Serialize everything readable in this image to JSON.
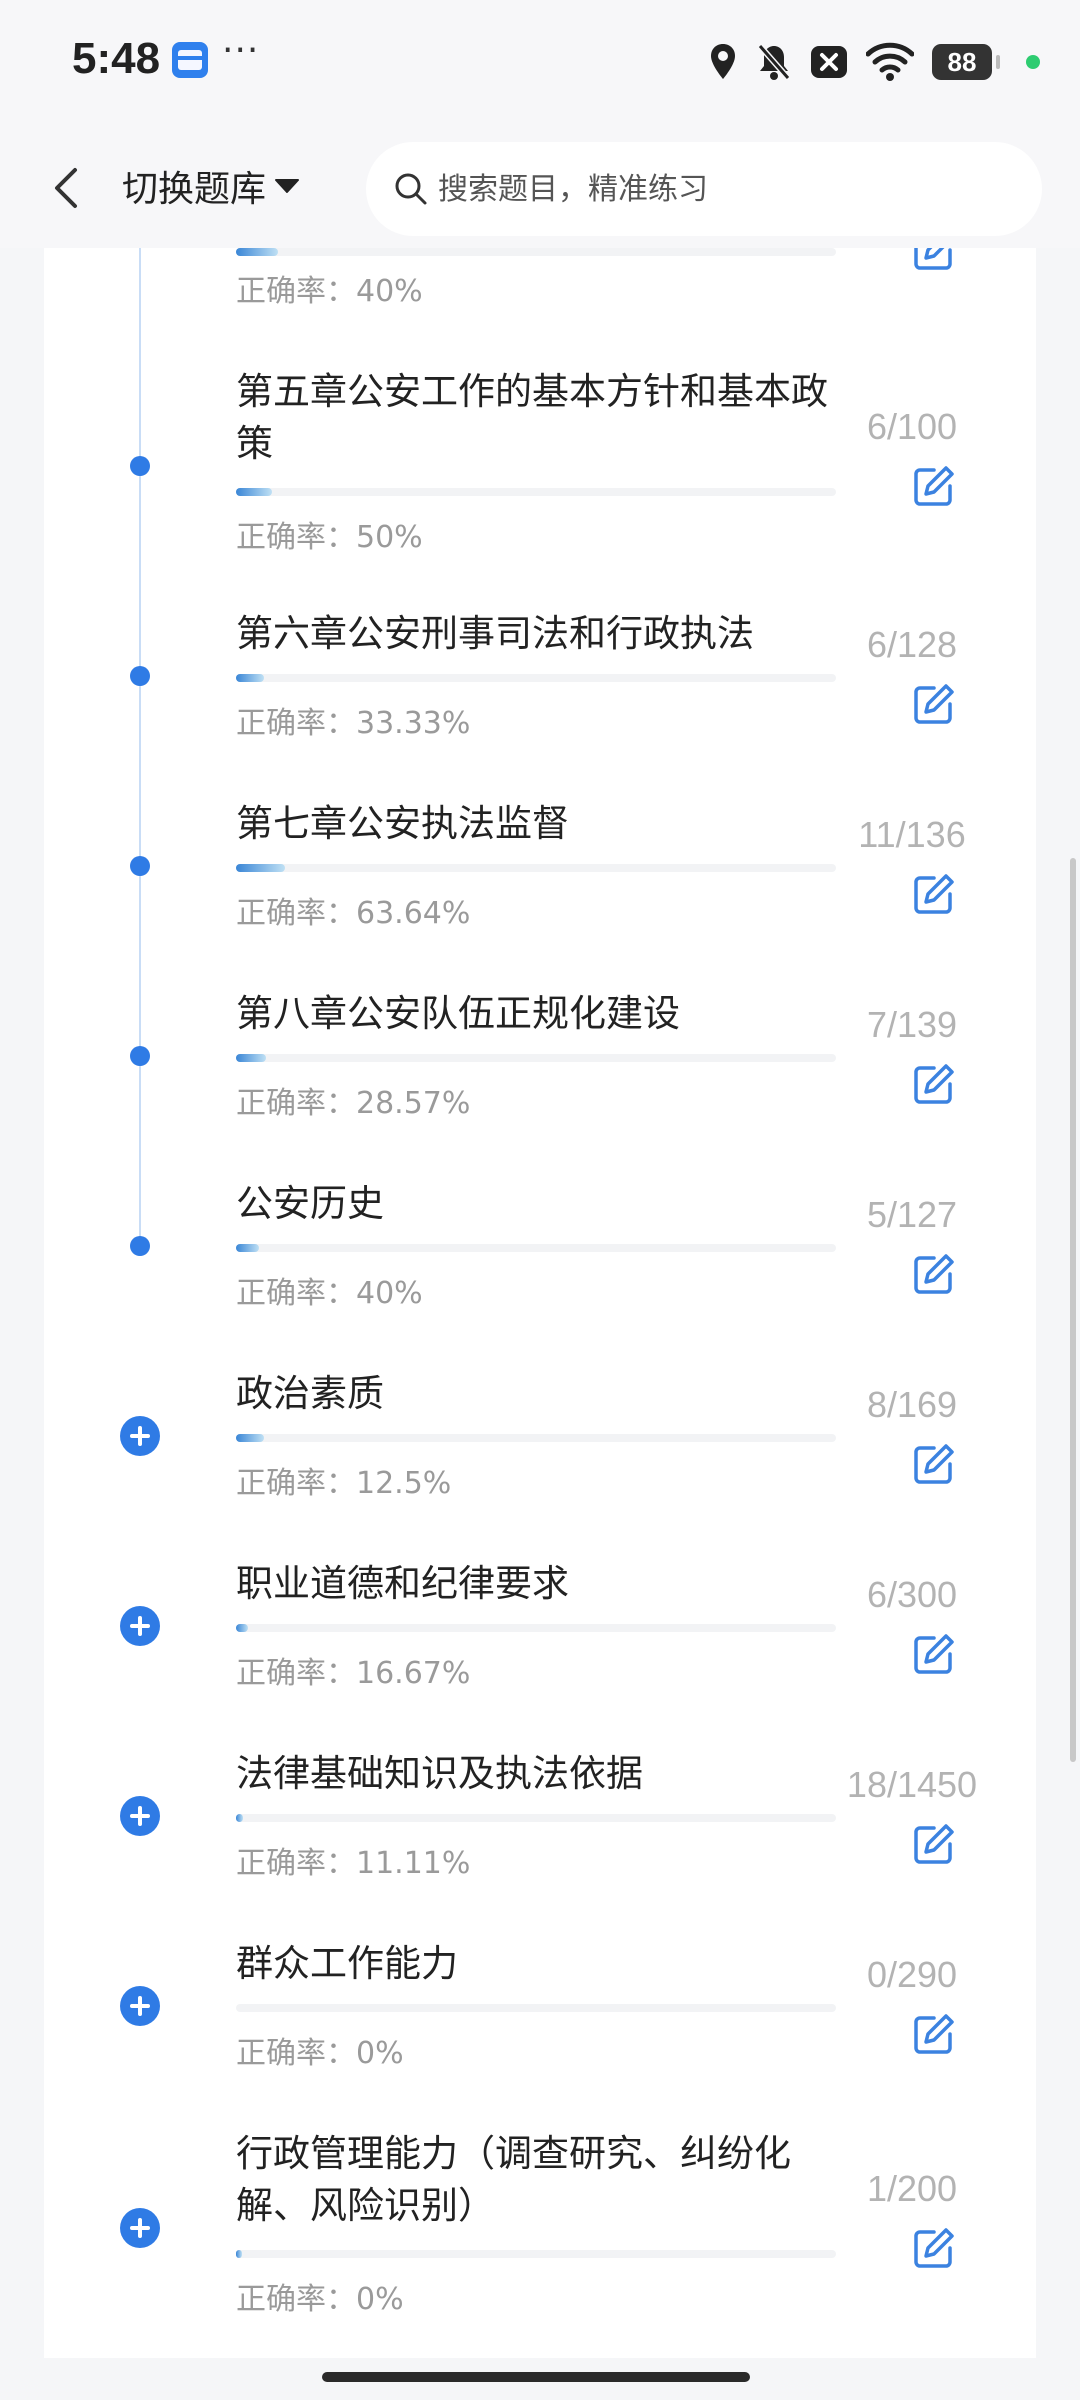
{
  "status_bar": {
    "time": "5:48",
    "more": "···",
    "battery": "88"
  },
  "header": {
    "switch_label": "切换题库",
    "search_placeholder": "搜索题目，精准练习"
  },
  "partial_item": {
    "accuracy_label": "正确率：40%",
    "progress": 0.07
  },
  "items": [
    {
      "title": "第五章公安工作的基本方针和基本政策",
      "count": "6/100",
      "accuracy": "正确率：50%",
      "progress": 0.06,
      "marker": "dot"
    },
    {
      "title": "第六章公安刑事司法和行政执法",
      "count": "6/128",
      "accuracy": "正确率：33.33%",
      "progress": 0.047,
      "marker": "dot"
    },
    {
      "title": "第七章公安执法监督",
      "count": "11/136",
      "accuracy": "正确率：63.64%",
      "progress": 0.081,
      "marker": "dot"
    },
    {
      "title": "第八章公安队伍正规化建设",
      "count": "7/139",
      "accuracy": "正确率：28.57%",
      "progress": 0.05,
      "marker": "dot"
    },
    {
      "title": "公安历史",
      "count": "5/127",
      "accuracy": "正确率：40%",
      "progress": 0.039,
      "marker": "dot"
    },
    {
      "title": "政治素质",
      "count": "8/169",
      "accuracy": "正确率：12.5%",
      "progress": 0.047,
      "marker": "plus"
    },
    {
      "title": "职业道德和纪律要求",
      "count": "6/300",
      "accuracy": "正确率：16.67%",
      "progress": 0.02,
      "marker": "plus"
    },
    {
      "title": "法律基础知识及执法依据",
      "count": "18/1450",
      "accuracy": "正确率：11.11%",
      "progress": 0.012,
      "marker": "plus"
    },
    {
      "title": "群众工作能力",
      "count": "0/290",
      "accuracy": "正确率：0%",
      "progress": 0.0,
      "marker": "plus"
    },
    {
      "title": "行政管理能力（调查研究、纠纷化解、风险识别）",
      "count": "1/200",
      "accuracy": "正确率：0%",
      "progress": 0.005,
      "marker": "plus"
    }
  ],
  "colors": {
    "accent": "#2f7be5",
    "count_gray": "#b3b3b3",
    "accuracy_gray": "#9a9a9a"
  }
}
